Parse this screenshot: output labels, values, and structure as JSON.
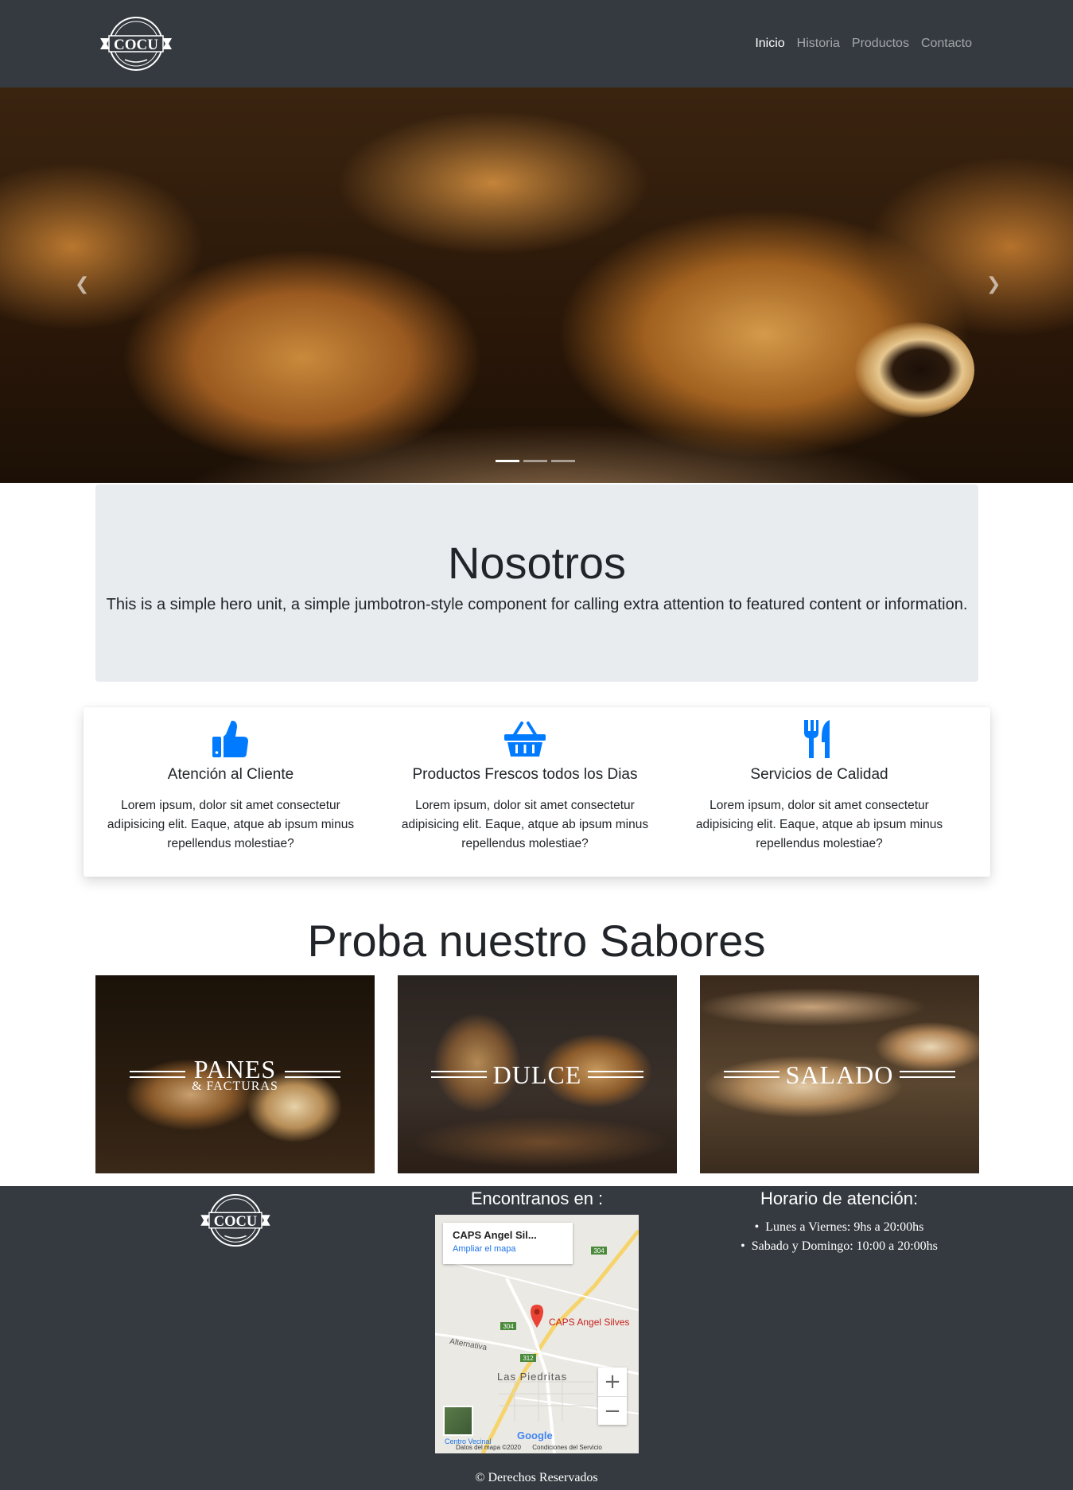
{
  "brand": {
    "logo_text": "COCU",
    "logo_arc_text": ""
  },
  "nav": {
    "items": [
      {
        "label": "Inicio",
        "active": true
      },
      {
        "label": "Historia",
        "active": false
      },
      {
        "label": "Productos",
        "active": false
      },
      {
        "label": "Contacto",
        "active": false
      }
    ]
  },
  "carousel": {
    "prev_icon": "chevron-left-icon",
    "next_icon": "chevron-right-icon",
    "indicator_count": 3,
    "active_indicator": 1
  },
  "jumbotron": {
    "title": "Nosotros",
    "text": "This is a simple hero unit, a simple jumbotron-style component for calling extra attention to featured content or information."
  },
  "features": [
    {
      "icon": "thumbs-up-icon",
      "title": "Atención al Cliente",
      "text": "Lorem ipsum, dolor sit amet consectetur adipisicing elit. Eaque, atque ab ipsum minus repellendus molestiae?"
    },
    {
      "icon": "shopping-basket-icon",
      "title": "Productos Frescos todos los Dias",
      "text": "Lorem ipsum, dolor sit amet consectetur adipisicing elit. Eaque, atque ab ipsum minus repellendus molestiae?"
    },
    {
      "icon": "utensils-icon",
      "title": "Servicios de Calidad",
      "text": "Lorem ipsum, dolor sit amet consectetur adipisicing elit. Eaque, atque ab ipsum minus repellendus molestiae?"
    }
  ],
  "sabores": {
    "title": "Proba nuestro Sabores",
    "cards": [
      {
        "label": "PANES",
        "sublabel": "& FACTURAS"
      },
      {
        "label": "DULCE",
        "sublabel": ""
      },
      {
        "label": "SALADO",
        "sublabel": ""
      }
    ]
  },
  "footer": {
    "map_title": "Encontranos en :",
    "map": {
      "place_name": "CAPS Angel Sil...",
      "enlarge_link": "Ampliar el mapa",
      "pin_label": "CAPS Angel Silves",
      "town": "Las Piedritas",
      "road_label": "Alternativa",
      "route_labels": [
        "304",
        "304",
        "312"
      ],
      "zoom_in": "+",
      "zoom_out": "−",
      "google": "Google",
      "vecinal": "Centro Vecinal",
      "credits": "Datos del mapa ©2020",
      "terms": "Condiciones del Servicio"
    },
    "horario_title": "Horario de atención:",
    "horario": [
      "Lunes a Viernes: 9hs a 20:00hs",
      "Sabado y Domingo: 10:00 a 20:00hs"
    ],
    "copyright": "© Derechos Reservados"
  },
  "colors": {
    "navbar_bg": "#343a40",
    "accent_blue": "#007bff",
    "jumbotron_bg": "#e9ecef"
  }
}
